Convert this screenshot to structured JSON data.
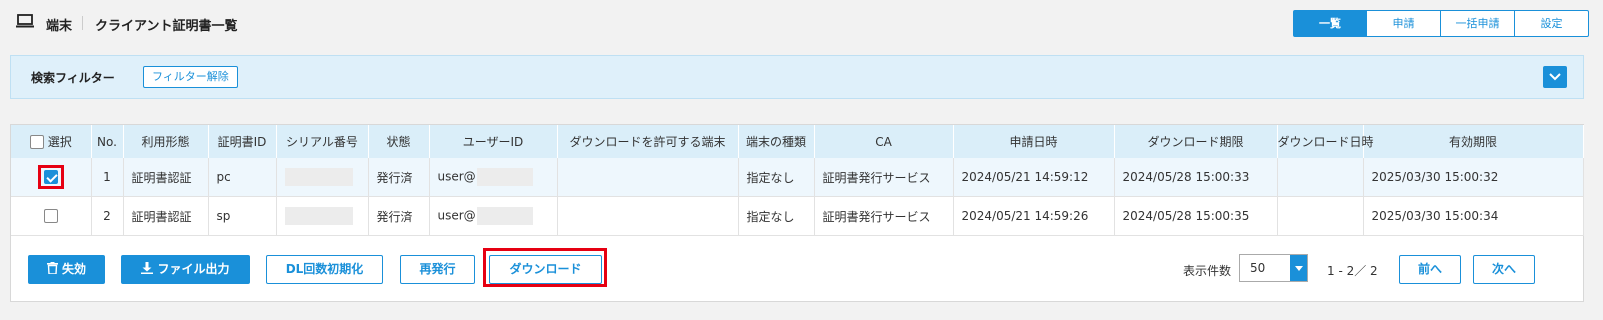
{
  "header": {
    "section": "端末",
    "title": "クライアント証明書一覧",
    "tabs": [
      {
        "label": "一覧",
        "active": true
      },
      {
        "label": "申請",
        "active": false
      },
      {
        "label": "一括申請",
        "active": false
      },
      {
        "label": "設定",
        "active": false
      }
    ]
  },
  "filter": {
    "title": "検索フィルター",
    "clear_label": "フィルター解除"
  },
  "table": {
    "select_label": "選択",
    "columns": [
      "No.",
      "利用形態",
      "証明書ID",
      "シリアル番号",
      "状態",
      "ユーザーID",
      "ダウンロードを許可する端末",
      "端末の種類",
      "CA",
      "申請日時",
      "ダウンロード期限",
      "ダウンロード日時",
      "有効期限"
    ],
    "rows": [
      {
        "selected": true,
        "no": "1",
        "usage": "証明書認証",
        "cert_id": "pc",
        "serial": "",
        "status": "発行済",
        "user_id": "user@",
        "allowed_device": "",
        "device_type": "指定なし",
        "ca": "証明書発行サービス",
        "applied_at": "2024/05/21 14:59:12",
        "download_deadline": "2024/05/28 15:00:33",
        "downloaded_at": "",
        "expires": "2025/03/30 15:00:32"
      },
      {
        "selected": false,
        "no": "2",
        "usage": "証明書認証",
        "cert_id": "sp",
        "serial": "",
        "status": "発行済",
        "user_id": "user@",
        "allowed_device": "",
        "device_type": "指定なし",
        "ca": "証明書発行サービス",
        "applied_at": "2024/05/21 14:59:26",
        "download_deadline": "2024/05/28 15:00:35",
        "downloaded_at": "",
        "expires": "2025/03/30 15:00:34"
      }
    ]
  },
  "actions": {
    "revoke": "失効",
    "export": "ファイル出力",
    "reset_dl": "DL回数初期化",
    "reissue": "再発行",
    "download": "ダウンロード"
  },
  "pagination": {
    "per_page_label": "表示件数",
    "per_page_value": "50",
    "range": "1 - 2／ 2",
    "prev": "前へ",
    "next": "次へ"
  },
  "colors": {
    "accent": "#1a90d9",
    "highlight": "#e60012",
    "header_row": "#daeef9",
    "filter_bg": "#dff0fa"
  }
}
